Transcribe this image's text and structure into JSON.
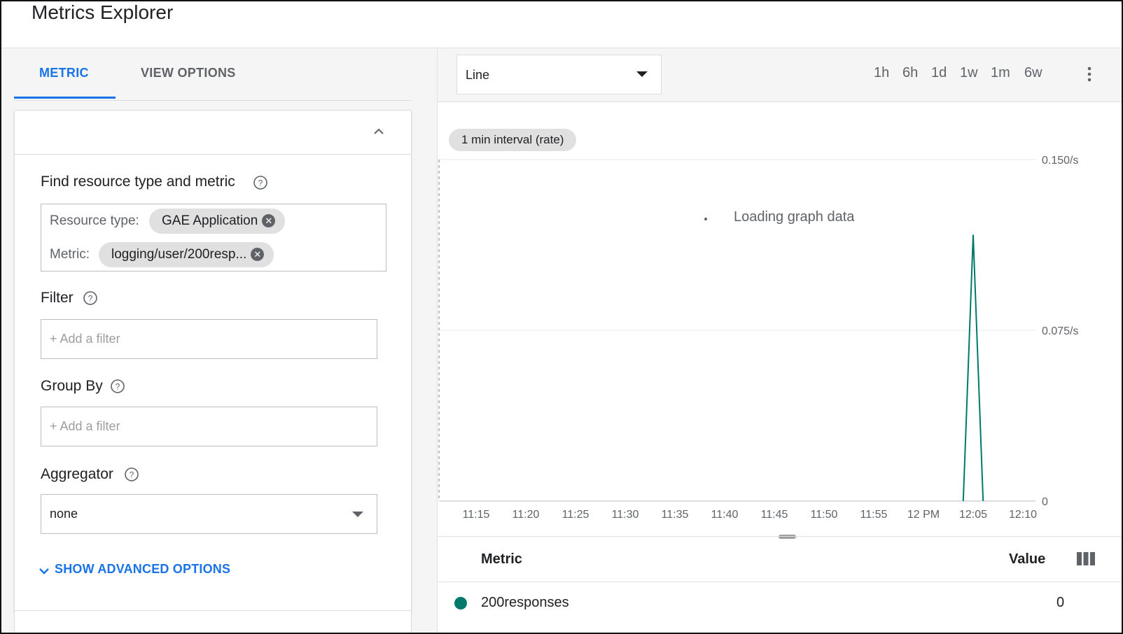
{
  "header": {
    "title": "Metrics Explorer"
  },
  "left": {
    "tabs": [
      {
        "label": "METRIC",
        "active": true
      },
      {
        "label": "VIEW OPTIONS",
        "active": false
      }
    ],
    "find": {
      "label": "Find resource type and metric",
      "resource_type_label": "Resource type:",
      "resource_type_value": "GAE Application",
      "metric_label": "Metric:",
      "metric_value": "logging/user/200resp..."
    },
    "filter": {
      "label": "Filter",
      "placeholder": "+ Add a filter"
    },
    "group_by": {
      "label": "Group By",
      "placeholder": "+ Add a filter"
    },
    "aggregator": {
      "label": "Aggregator",
      "value": "none"
    },
    "advanced_label": "SHOW ADVANCED OPTIONS"
  },
  "right": {
    "chart_type": "Line",
    "ranges": [
      "1h",
      "6h",
      "1d",
      "1w",
      "1m",
      "6w"
    ],
    "active_range": "1h",
    "interval_chip": "1 min interval (rate)",
    "loading_text": "Loading graph data",
    "legend": {
      "metric_header": "Metric",
      "value_header": "Value",
      "rows": [
        {
          "name": "200responses",
          "value": "0",
          "color": "#00796b"
        }
      ]
    }
  },
  "colors": {
    "accent": "#1a73e8",
    "series": "#00796b"
  },
  "chart_data": {
    "type": "line",
    "xlabel": "",
    "ylabel": "",
    "x_ticks": [
      "11:15",
      "11:20",
      "11:25",
      "11:30",
      "11:35",
      "11:40",
      "11:45",
      "11:50",
      "11:55",
      "12 PM",
      "12:05",
      "12:10"
    ],
    "y_ticks": [
      "0",
      "0.075/s",
      "0.150/s"
    ],
    "ylim": [
      0,
      0.15
    ],
    "grid": true,
    "series": [
      {
        "name": "200responses",
        "color": "#00796b",
        "x": [
          "12:04",
          "12:05",
          "12:06"
        ],
        "values": [
          0,
          0.117,
          0
        ]
      }
    ]
  }
}
